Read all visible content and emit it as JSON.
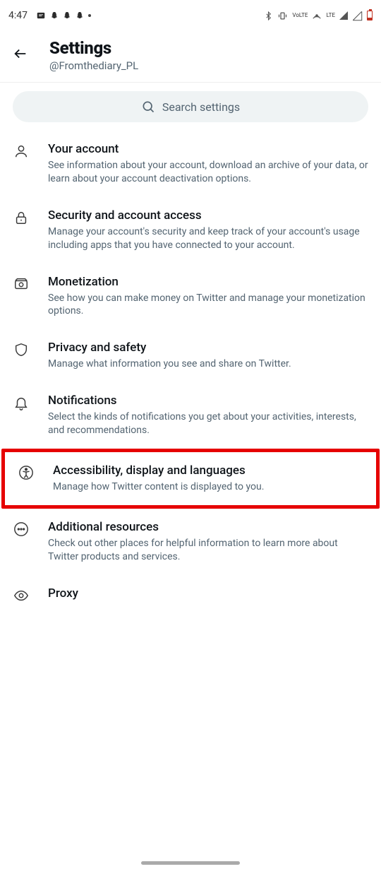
{
  "status": {
    "time": "4:47",
    "lteLabel": "LTE",
    "volteLabel": "VoLTE"
  },
  "header": {
    "title": "Settings",
    "username": "@Fromthediary_PL"
  },
  "search": {
    "placeholder": "Search settings"
  },
  "items": [
    {
      "icon": "person-icon",
      "title": "Your account",
      "desc": "See information about your account, download an archive of your data, or learn about your account deactivation options."
    },
    {
      "icon": "lock-icon",
      "title": "Security and account access",
      "desc": "Manage your account's security and keep track of your account's usage including apps that you have connected to your account."
    },
    {
      "icon": "money-icon",
      "title": "Monetization",
      "desc": "See how you can make money on Twitter and manage your monetization options."
    },
    {
      "icon": "shield-icon",
      "title": "Privacy and safety",
      "desc": "Manage what information you see and share on Twitter."
    },
    {
      "icon": "bell-icon",
      "title": "Notifications",
      "desc": "Select the kinds of notifications you get about your activities, interests, and recommendations."
    },
    {
      "icon": "accessibility-icon",
      "title": "Accessibility, display and languages",
      "desc": "Manage how Twitter content is displayed to you.",
      "highlighted": true
    },
    {
      "icon": "more-icon",
      "title": "Additional resources",
      "desc": "Check out other places for helpful information to learn more about Twitter products and services."
    },
    {
      "icon": "eye-icon",
      "title": "Proxy",
      "desc": ""
    }
  ]
}
